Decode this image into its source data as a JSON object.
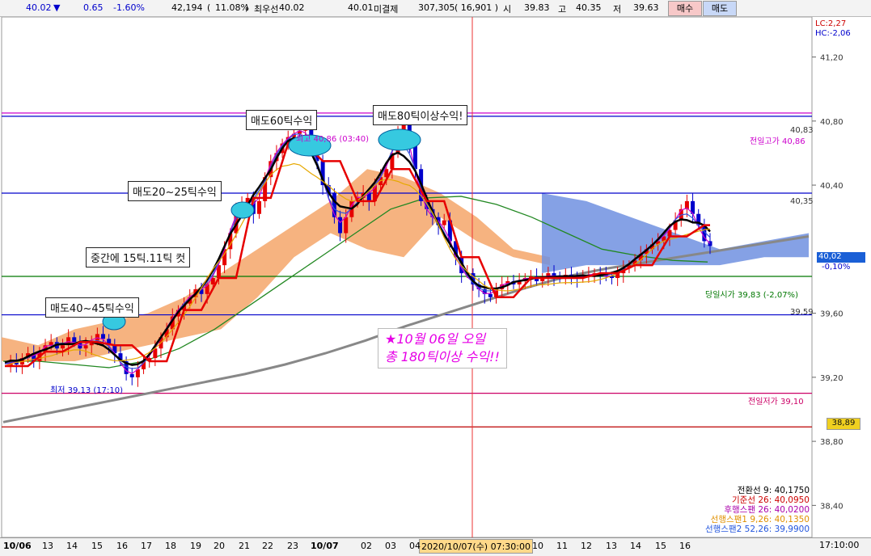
{
  "topbar": {
    "price": "40.02",
    "arrow": "▼",
    "change": "0.65",
    "change_pct": "-1.60%",
    "volume": "42,194",
    "vol_pct_open": "(",
    "vol_pct": "11.08%",
    "vol_pct_close": ")",
    "best_label": "최우선",
    "best_ask": "40.02",
    "best_bid": "40.01",
    "open_int_label": "미결제",
    "open_int": "307,305",
    "oi_change": "( 16,901 )",
    "open_label": "시",
    "open": "39.83",
    "high_label": "고",
    "high": "40.35",
    "low_label": "저",
    "low": "39.63",
    "buy_button": "매수",
    "sell_button": "매도"
  },
  "chart_data": {
    "type": "candlestick",
    "ylim": [
      38.2,
      41.45
    ],
    "y_ticks": [
      {
        "v": 41.2,
        "label": "41,20"
      },
      {
        "v": 40.8,
        "label": "40,80"
      },
      {
        "v": 40.4,
        "label": "40,40"
      },
      {
        "v": 39.6,
        "label": "39,60"
      },
      {
        "v": 39.2,
        "label": "39,20"
      },
      {
        "v": 38.8,
        "label": "38,80"
      },
      {
        "v": 38.4,
        "label": "38,40"
      }
    ],
    "lc_label": "LC:2,27",
    "hc_label": "HC:-2,06",
    "current_price_tag": "40,02",
    "current_pct_tag": "-0,10%",
    "price_38_89": "38,89",
    "x_labels": [
      "10/06",
      "13",
      "14",
      "15",
      "16",
      "17",
      "18",
      "19",
      "20",
      "21",
      "22",
      "23",
      "10/07",
      "02",
      "03",
      "04",
      "10",
      "11",
      "12",
      "13",
      "14",
      "15",
      "16"
    ],
    "time_cursor": "2020/10/07(수) 07:30:00",
    "clock": "17:10:00",
    "hlines": [
      {
        "v": 40.85,
        "color": "#cc00cc",
        "label": "",
        "note": "전일고가 40,86",
        "right_label": "40,83"
      },
      {
        "v": 40.83,
        "color": "#0000cc",
        "label": "40,83"
      },
      {
        "v": 40.35,
        "color": "#0000cc",
        "label": "40,35"
      },
      {
        "v": 39.83,
        "color": "#007700",
        "note": "당일시가 39,83 (-2,07%)"
      },
      {
        "v": 39.59,
        "color": "#0000cc",
        "label": "39,59"
      },
      {
        "v": 39.1,
        "color": "#cc0066",
        "note": "전일저가 39,10"
      },
      {
        "v": 38.89,
        "color": "#bb0000"
      }
    ],
    "min_label": "최저 39,13 (17:10)",
    "max_label": "최고 40,86 (03:40)",
    "close_series": [
      39.27,
      39.3,
      39.28,
      39.32,
      39.35,
      39.3,
      39.36,
      39.4,
      39.42,
      39.38,
      39.4,
      39.45,
      39.42,
      39.38,
      39.4,
      39.43,
      39.47,
      39.44,
      39.4,
      39.35,
      39.3,
      39.22,
      39.2,
      39.25,
      39.3,
      39.32,
      39.38,
      39.45,
      39.5,
      39.58,
      39.62,
      39.66,
      39.7,
      39.75,
      39.72,
      39.78,
      39.82,
      39.9,
      40.0,
      40.1,
      40.25,
      40.28,
      40.32,
      40.22,
      40.3,
      40.45,
      40.55,
      40.6,
      40.66,
      40.7,
      40.72,
      40.74,
      40.76,
      40.68,
      40.55,
      40.4,
      40.35,
      40.2,
      40.1,
      40.2,
      40.3,
      40.32,
      40.35,
      40.3,
      40.4,
      40.45,
      40.5,
      40.6,
      40.72,
      40.8,
      40.65,
      40.5,
      40.3,
      40.25,
      40.2,
      40.15,
      40.18,
      40.05,
      39.95,
      39.85,
      39.85,
      39.78,
      39.75,
      39.72,
      39.7,
      39.75,
      39.78,
      39.8,
      39.78,
      39.8,
      39.82,
      39.83,
      39.8,
      39.82,
      39.85,
      39.83,
      39.82,
      39.84,
      39.83,
      39.82,
      39.83,
      39.84,
      39.85,
      39.84,
      39.83,
      39.82,
      39.85,
      39.88,
      39.9,
      39.93,
      39.97,
      40.0,
      40.03,
      40.05,
      40.08,
      40.12,
      40.18,
      40.25,
      40.3,
      40.22,
      40.15,
      40.05,
      40.02
    ],
    "sma_gray": [
      38.92,
      38.97,
      39.02,
      39.07,
      39.12,
      39.17,
      39.22,
      39.28,
      39.35,
      39.43,
      39.52,
      39.6,
      39.68,
      39.76,
      39.83,
      39.88,
      39.92,
      39.96,
      40.0,
      40.04,
      40.08
    ],
    "sma_green": [
      39.3,
      39.3,
      39.28,
      39.26,
      39.3,
      39.38,
      39.5,
      39.65,
      39.8,
      39.95,
      40.1,
      40.25,
      40.32,
      40.33,
      40.28,
      40.2,
      40.1,
      40.0,
      39.96,
      39.93,
      39.92
    ],
    "cloud_orange": [
      [
        39.45,
        39.3
      ],
      [
        39.4,
        39.3
      ],
      [
        39.5,
        39.3
      ],
      [
        39.55,
        39.35
      ],
      [
        39.6,
        39.4
      ],
      [
        39.7,
        39.45
      ],
      [
        39.85,
        39.5
      ],
      [
        40.0,
        39.7
      ],
      [
        40.15,
        39.95
      ],
      [
        40.3,
        40.1
      ],
      [
        40.5,
        40.0
      ],
      [
        40.45,
        39.95
      ],
      [
        40.35,
        40.2
      ],
      [
        40.2,
        40.05
      ],
      [
        40.0,
        39.95
      ],
      [
        39.95,
        39.9
      ]
    ],
    "cloud_blue": [
      [
        40.35,
        39.85
      ],
      [
        40.3,
        39.9
      ],
      [
        40.2,
        39.9
      ],
      [
        40.1,
        39.9
      ],
      [
        40.0,
        39.9
      ],
      [
        40.05,
        39.95
      ],
      [
        40.1,
        39.95
      ]
    ],
    "annotations": [
      {
        "text": "매도40~45틱수익"
      },
      {
        "text": "중간에 15틱.11틱 컷"
      },
      {
        "text": "매도20~25틱수익"
      },
      {
        "text": "매도60틱수익"
      },
      {
        "text": "매도80틱이상수익!"
      }
    ],
    "highlight_text_line1": "★10월 06일 오일",
    "highlight_text_line2": "총 180틱이상 수익!!"
  },
  "legend": {
    "l1": "전환선 9: 40,1750",
    "l2": "기준선 26: 40,0950",
    "l3": "후행스팬 26: 40,0200",
    "l4": "선행스팬1 9,26: 40,1350",
    "l5": "선행스팬2 52,26: 39,9900"
  },
  "colors": {
    "red": "#e60000",
    "black": "#000000",
    "blue": "#0000cc",
    "orange_cloud": "#f4a66a",
    "blue_cloud": "#7090e0",
    "gray": "#888888",
    "green": "#228822",
    "yellow": "#e6a800"
  }
}
